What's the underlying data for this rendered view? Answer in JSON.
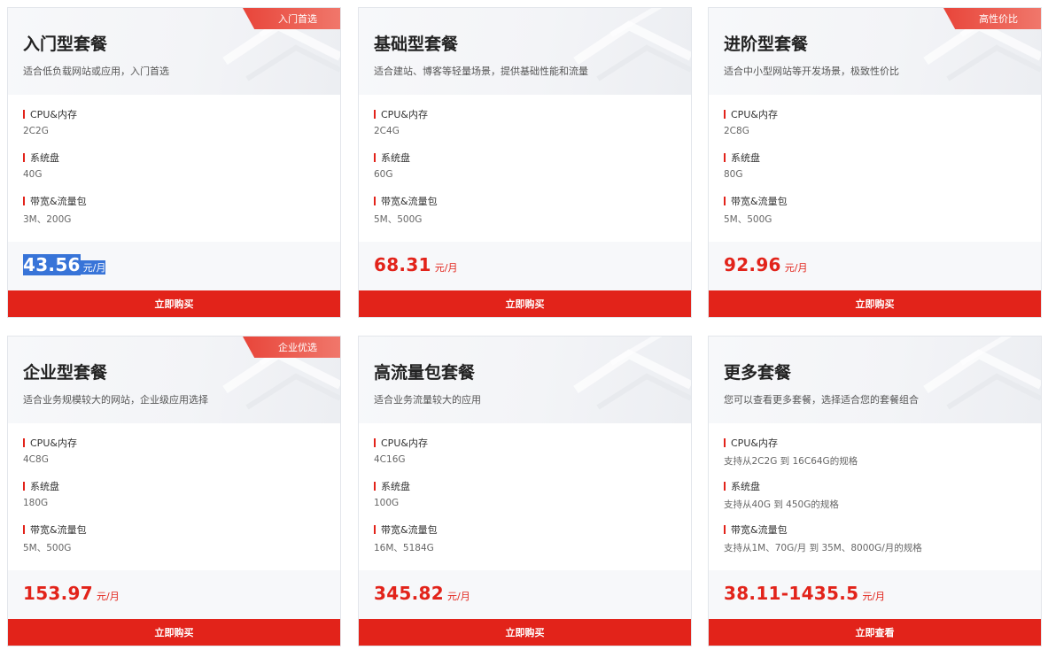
{
  "plans": [
    {
      "title": "入门型套餐",
      "desc": "适合低负载网站或应用，入门首选",
      "badge": "入门首选",
      "specs": [
        {
          "label": "CPU&内存",
          "value": "2C2G"
        },
        {
          "label": "系统盘",
          "value": "40G"
        },
        {
          "label": "带宽&流量包",
          "value": "3M、200G"
        }
      ],
      "price": "43.56",
      "unit": "元/月",
      "button": "立即购买"
    },
    {
      "title": "基础型套餐",
      "desc": "适合建站、博客等轻量场景，提供基础性能和流量",
      "badge": "",
      "specs": [
        {
          "label": "CPU&内存",
          "value": "2C4G"
        },
        {
          "label": "系统盘",
          "value": "60G"
        },
        {
          "label": "带宽&流量包",
          "value": "5M、500G"
        }
      ],
      "price": "68.31",
      "unit": "元/月",
      "button": "立即购买"
    },
    {
      "title": "进阶型套餐",
      "desc": "适合中小型网站等开发场景，极致性价比",
      "badge": "高性价比",
      "specs": [
        {
          "label": "CPU&内存",
          "value": "2C8G"
        },
        {
          "label": "系统盘",
          "value": "80G"
        },
        {
          "label": "带宽&流量包",
          "value": "5M、500G"
        }
      ],
      "price": "92.96",
      "unit": "元/月",
      "button": "立即购买"
    },
    {
      "title": "企业型套餐",
      "desc": "适合业务规模较大的网站，企业级应用选择",
      "badge": "企业优选",
      "specs": [
        {
          "label": "CPU&内存",
          "value": "4C8G"
        },
        {
          "label": "系统盘",
          "value": "180G"
        },
        {
          "label": "带宽&流量包",
          "value": "5M、500G"
        }
      ],
      "price": "153.97",
      "unit": "元/月",
      "button": "立即购买"
    },
    {
      "title": "高流量包套餐",
      "desc": "适合业务流量较大的应用",
      "badge": "",
      "specs": [
        {
          "label": "CPU&内存",
          "value": "4C16G"
        },
        {
          "label": "系统盘",
          "value": "100G"
        },
        {
          "label": "带宽&流量包",
          "value": "16M、5184G"
        }
      ],
      "price": "345.82",
      "unit": "元/月",
      "button": "立即购买"
    },
    {
      "title": "更多套餐",
      "desc": "您可以查看更多套餐，选择适合您的套餐组合",
      "badge": "",
      "specs": [
        {
          "label": "CPU&内存",
          "value": "支持从2C2G 到 16C64G的规格"
        },
        {
          "label": "系统盘",
          "value": "支持从40G 到 450G的规格"
        },
        {
          "label": "带宽&流量包",
          "value": "支持从1M、70G/月 到 35M、8000G/月的规格"
        }
      ],
      "price": "38.11-1435.5",
      "unit": "元/月",
      "button": "立即查看"
    }
  ],
  "colors": {
    "accent": "#e2231a",
    "selection": "#3874d8",
    "card_border": "#e3e6eb"
  }
}
